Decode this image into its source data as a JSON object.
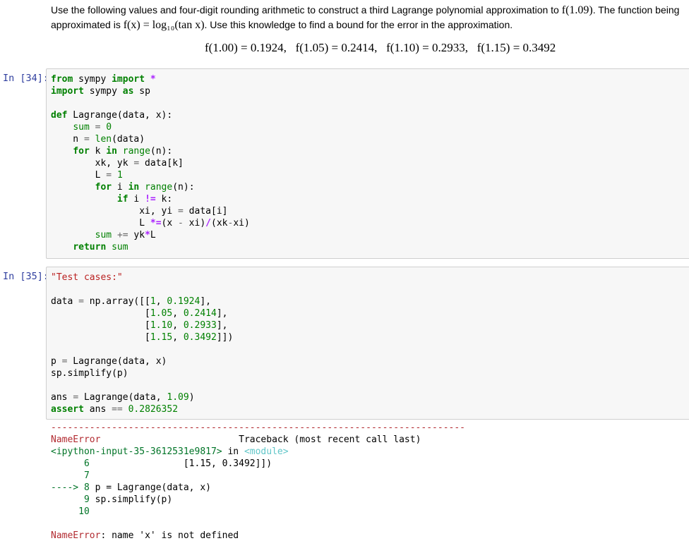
{
  "problem": {
    "line1_a": "Use the following values and four-digit rounding arithmetic to construct a third Lagrange polynomial approximation to ",
    "line1_math": "f(1.09)",
    "line1_b": ". The function being",
    "line2_a": "approximated is ",
    "line2_math": "f(x) = log₁₀(tan x)",
    "line2_b": ". Use this knowledge to find a bound for the error in the approximation.",
    "equation": "f(1.00) = 0.1924,   f(1.05) = 0.2414,   f(1.10) = 0.2933,   f(1.15) = 0.3492"
  },
  "cells": [
    {
      "prompt": "In [34]:",
      "lines": [
        "from sympy import *",
        "import sympy as sp",
        "",
        "def Lagrange(data, x):",
        "    sum = 0",
        "    n = len(data)",
        "    for k in range(n):",
        "        xk, yk = data[k]",
        "        L = 1",
        "        for i in range(n):",
        "            if i != k:",
        "                xi, yi = data[i]",
        "                L *=(x - xi)/(xk-xi)",
        "        sum += yk*L",
        "    return sum"
      ]
    },
    {
      "prompt": "In [35]:",
      "lines": [
        "\"Test cases:\"",
        "",
        "data = np.array([[1, 0.1924],",
        "                 [1.05, 0.2414],",
        "                 [1.10, 0.2933],",
        "                 [1.15, 0.3492]])",
        "",
        "p = Lagrange(data, x)",
        "sp.simplify(p)",
        "",
        "ans = Lagrange(data, 1.09)",
        "assert ans == 0.2826352"
      ]
    }
  ],
  "error_output": {
    "separator": "---------------------------------------------------------------------------",
    "error_name": "NameError",
    "traceback_header": "Traceback (most recent call last)",
    "input_ref": "<ipython-input-35-3612531e9817>",
    "in_word": " in ",
    "module": "<module>",
    "tb_line6_no": "6",
    "tb_line6_code": "                 [1.15, 0.3492]])",
    "tb_line7_no": "7",
    "tb_arrow": "---->",
    "tb_line8_no": "8",
    "tb_line8_code": "p = Lagrange(data, x)",
    "tb_line9_no": "9",
    "tb_line9_code": "sp.simplify(p)",
    "tb_line10_no": "10",
    "final_message": ": name 'x' is not defined"
  }
}
